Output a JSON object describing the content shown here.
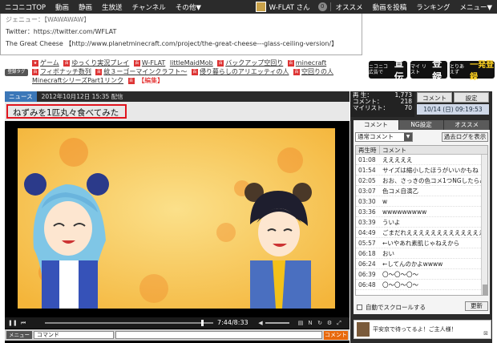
{
  "topnav": {
    "items": [
      "ニコニコTOP",
      "動画",
      "静画",
      "生放送",
      "チャンネル",
      "その他▼"
    ],
    "user": "W-FLAT さん",
    "badge": "0",
    "right_items": [
      "オススメ",
      "動画を投稿",
      "ランキング",
      "メニュー▼"
    ]
  },
  "description": {
    "line1": "ジェニュー：【WAWAWAW】",
    "line2": "Twitter：https://twitter.com/WFLAT",
    "line3": "The Great Cheese 【http://www.planetminecraft.com/project/the-great-cheese---glass-ceiling-version/】"
  },
  "tags": {
    "button_label": "登録タグ",
    "row1": [
      "ゲーム",
      "ゆっくり実況プレイ",
      "W-FLAT",
      "littleMaidMob",
      "バックアップ空回り",
      "minecraft"
    ],
    "row2": [
      "フィボナッチ数列",
      "紋３ーゴーマインクラフト〜",
      "侵り暮らしのアリエッティの人",
      "空回りの人"
    ],
    "row3": [
      "MinecraftシリーズPart1リンク"
    ],
    "edit_label": "【編集】"
  },
  "ads": {
    "btn1_small": "ニコニコ 広告で",
    "btn1": "宣伝",
    "btn2_small": "マイ リスト",
    "btn2": "登録",
    "btn3_small": "とりあえず",
    "btn3": "一発登録"
  },
  "player": {
    "category": "ニュース",
    "post_date": "2012年10月12日 15:35 配信",
    "title": "ねずみを1匹丸々食べてみた",
    "timer": "7:44/8:33",
    "seek_fraction": 0.93,
    "command_label": "メニュー",
    "command_value": "コマンド",
    "send_label": "コメント"
  },
  "stats": {
    "play_label": "再 生：",
    "play_value": "1,773",
    "comment_label": "コメント：",
    "comment_value": "218",
    "mylist_label": "マイリスト：",
    "mylist_value": "70"
  },
  "right_tabs": {
    "comment": "コメント",
    "settings": "設定",
    "datetime": "10/14 (日) 09:19:53"
  },
  "comment_panel": {
    "tabs": [
      "コメント",
      "NG設定",
      "オススメ"
    ],
    "selector": "通常コメント",
    "past_log": "過去ログを表示",
    "col_time": "再生時",
    "col_comment": "コメント",
    "rows": [
      {
        "t": "01:08",
        "c": "えええええ"
      },
      {
        "t": "01:54",
        "c": "サイズは縮小したほうがいいかもね"
      },
      {
        "t": "02:05",
        "c": "おお、さっきの色コメ1つNGしたらみんな"
      },
      {
        "t": "03:07",
        "c": "色コメ自演乙"
      },
      {
        "t": "03:30",
        "c": "w"
      },
      {
        "t": "03:36",
        "c": "wwwwwwwww"
      },
      {
        "t": "03:39",
        "c": "ういよ"
      },
      {
        "t": "04:49",
        "c": "ごまだれええええええええええええええ"
      },
      {
        "t": "05:57",
        "c": "←いやあれ素肌じゃねえから"
      },
      {
        "t": "06:18",
        "c": "おい"
      },
      {
        "t": "06:24",
        "c": "←してんのかよwwww"
      },
      {
        "t": "06:39",
        "c": "〇〜〇〜〇〜"
      },
      {
        "t": "06:48",
        "c": "〇〜〇〜〇〜"
      }
    ],
    "auto_scroll": "自動でスクロールする",
    "refresh": "更新"
  },
  "message": {
    "text": "平安京で待ってるよ！ご主人様！"
  }
}
